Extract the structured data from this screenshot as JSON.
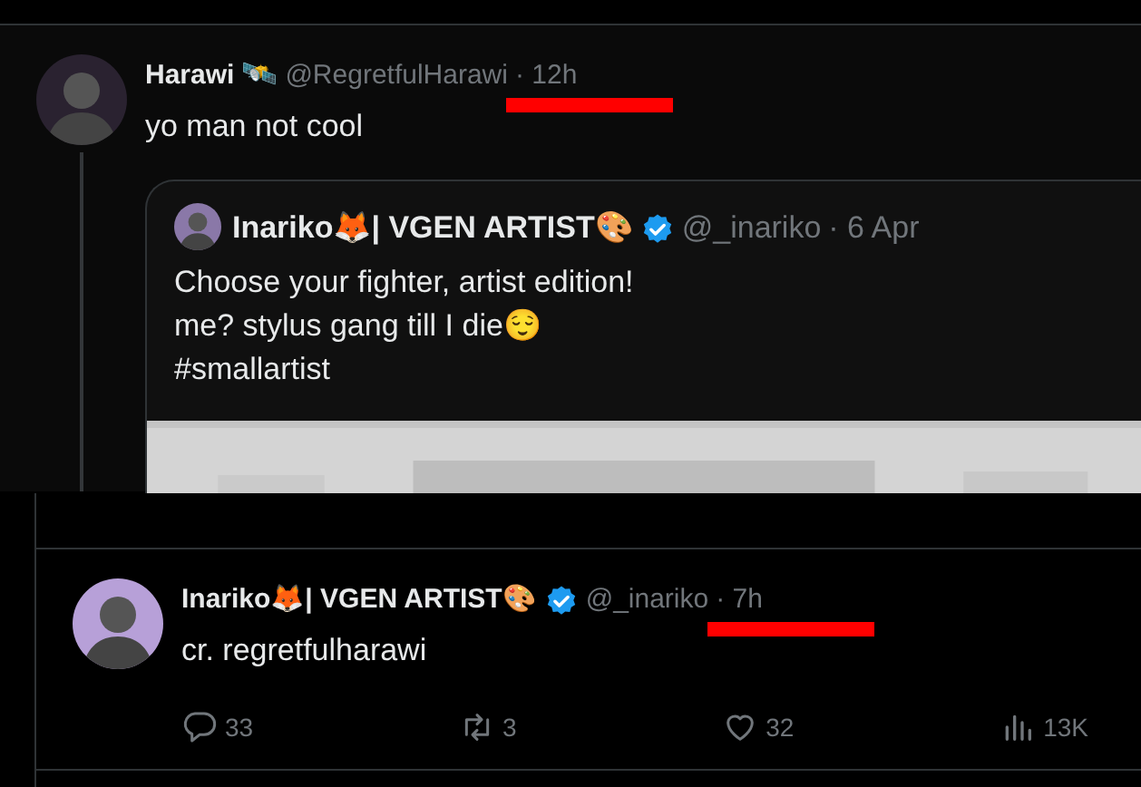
{
  "reply": {
    "author": {
      "name": "Harawi",
      "badge": "🛰️",
      "handle": "@RegretfulHarawi",
      "time": "· 12h",
      "underlined": true
    },
    "text": "yo man not cool",
    "quote": {
      "author": {
        "name": "Inariko🦊| VGEN ARTIST🎨",
        "verified": true,
        "handle": "@_inariko",
        "time": "· 6 Apr"
      },
      "lines": [
        "Choose your fighter, artist edition!",
        "me? stylus gang till I die😌",
        "#smallartist"
      ],
      "media": {
        "kind": "picture"
      }
    }
  },
  "post": {
    "author": {
      "name": "Inariko🦊| VGEN ARTIST🎨",
      "verified": true,
      "handle": "@_inariko",
      "time": "· 7h",
      "underlined": true
    },
    "text": "cr. regretfulharawi",
    "actions": [
      {
        "kind": "reply",
        "count": "33"
      },
      {
        "kind": "repost",
        "count": "3"
      },
      {
        "kind": "like",
        "count": "32"
      },
      {
        "kind": "views",
        "count": "13K"
      }
    ]
  }
}
